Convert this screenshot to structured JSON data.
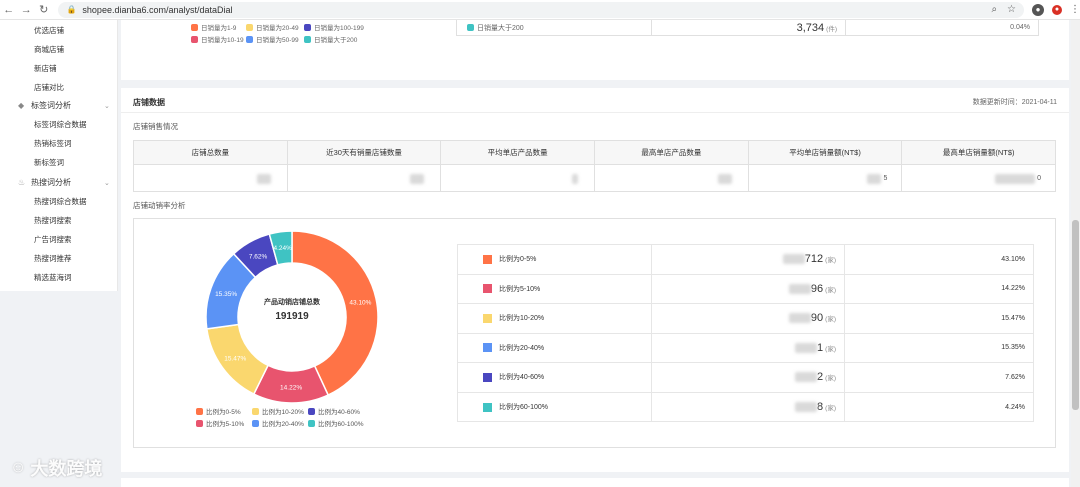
{
  "browser": {
    "url": "shopee.dianba6.com/analyst/dataDial"
  },
  "sidebar": {
    "items": [
      {
        "label": "优选店铺",
        "type": "item"
      },
      {
        "label": "商城店铺",
        "type": "item"
      },
      {
        "label": "新店铺",
        "type": "item"
      },
      {
        "label": "店铺对比",
        "type": "item"
      },
      {
        "label": "标签词分析",
        "type": "group"
      },
      {
        "label": "标签词综合数据",
        "type": "item"
      },
      {
        "label": "热销标签词",
        "type": "item"
      },
      {
        "label": "新标签词",
        "type": "item"
      },
      {
        "label": "热搜词分析",
        "type": "group"
      },
      {
        "label": "热搜词综合数据",
        "type": "item"
      },
      {
        "label": "热搜词搜索",
        "type": "item"
      },
      {
        "label": "广告词搜索",
        "type": "item"
      },
      {
        "label": "热搜词推荐",
        "type": "item"
      },
      {
        "label": "精选蓝海词",
        "type": "item"
      }
    ]
  },
  "top_card": {
    "legend": [
      {
        "label": "日销量为1-9",
        "color": "#ff7346"
      },
      {
        "label": "日销量为20-49",
        "color": "#fad76e"
      },
      {
        "label": "日销量为100-199",
        "color": "#4a47c0"
      },
      {
        "label": "日销量为10-19",
        "color": "#e8546e"
      },
      {
        "label": "日销量为50-99",
        "color": "#5b93f5"
      },
      {
        "label": "日销量大于200",
        "color": "#3fc3c3"
      }
    ],
    "row_label": "日销量大于200",
    "row_value": "3,734",
    "row_unit": "(件)",
    "row_pct": "0.04%"
  },
  "store_data": {
    "title": "店铺数据",
    "update_time": "数据更新时间：2021-04-11",
    "sales_subtitle": "店铺销售情况",
    "headers": [
      "店铺总数量",
      "近30天有销量店铺数量",
      "平均单店产品数量",
      "最高单店产品数量",
      "平均单店销量额(NT$)",
      "最高单店销量额(NT$)"
    ],
    "values_tail": [
      "",
      "",
      "",
      "",
      "5",
      "0"
    ],
    "turnover_subtitle": "店铺动销率分析",
    "donut_center_label": "产品动销店铺总数",
    "donut_center_value": "191919"
  },
  "chart_data": {
    "type": "pie",
    "title": "",
    "center_label": "产品动销店铺总数",
    "center_value": 191919,
    "slices": [
      {
        "name": "比例为0-5%",
        "value": 43.1,
        "label": "43.10%",
        "color": "#ff7346"
      },
      {
        "name": "比例为5-10%",
        "value": 14.22,
        "label": "14.22%",
        "color": "#e8546e"
      },
      {
        "name": "比例为10-20%",
        "value": 15.47,
        "label": "15.47%",
        "color": "#fad76e"
      },
      {
        "name": "比例为20-40%",
        "value": 15.35,
        "label": "15.35%",
        "color": "#5b93f5"
      },
      {
        "name": "比例为40-60%",
        "value": 7.62,
        "label": "7.62%",
        "color": "#4a47c0"
      },
      {
        "name": "比例为60-100%",
        "value": 4.24,
        "label": "4.24%",
        "color": "#3fc3c3"
      }
    ],
    "legend_order": [
      "比例为0-5%",
      "比例为10-20%",
      "比例为40-60%",
      "比例为5-10%",
      "比例为20-40%",
      "比例为60-100%"
    ]
  },
  "dist_rows": [
    {
      "label": "比例为0-5%",
      "num": "712",
      "unit": "(家)",
      "pct": "43.10%",
      "color": "#ff7346"
    },
    {
      "label": "比例为5-10%",
      "num": "96",
      "unit": "(家)",
      "pct": "14.22%",
      "color": "#e8546e"
    },
    {
      "label": "比例为10-20%",
      "num": "90",
      "unit": "(家)",
      "pct": "15.47%",
      "color": "#fad76e"
    },
    {
      "label": "比例为20-40%",
      "num": "1",
      "unit": "(家)",
      "pct": "15.35%",
      "color": "#5b93f5"
    },
    {
      "label": "比例为40-60%",
      "num": "2",
      "unit": "(家)",
      "pct": "7.62%",
      "color": "#4a47c0"
    },
    {
      "label": "比例为60-100%",
      "num": "8",
      "unit": "(家)",
      "pct": "4.24%",
      "color": "#3fc3c3"
    }
  ],
  "watermark": "大数跨境"
}
